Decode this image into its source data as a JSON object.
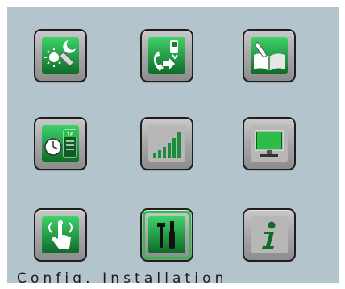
{
  "menu": {
    "caption": "Config. Installation",
    "selected_index": 7,
    "accent_color": "#2fbd4a",
    "tiles": [
      {
        "icon": "sun-moon-settings-icon"
      },
      {
        "icon": "phone-transfer-icon"
      },
      {
        "icon": "address-book-icon"
      },
      {
        "icon": "clock-calendar-icon"
      },
      {
        "icon": "signal-strength-icon"
      },
      {
        "icon": "monitor-display-icon"
      },
      {
        "icon": "touch-screen-icon"
      },
      {
        "icon": "installation-tools-icon"
      },
      {
        "icon": "information-icon"
      }
    ]
  }
}
